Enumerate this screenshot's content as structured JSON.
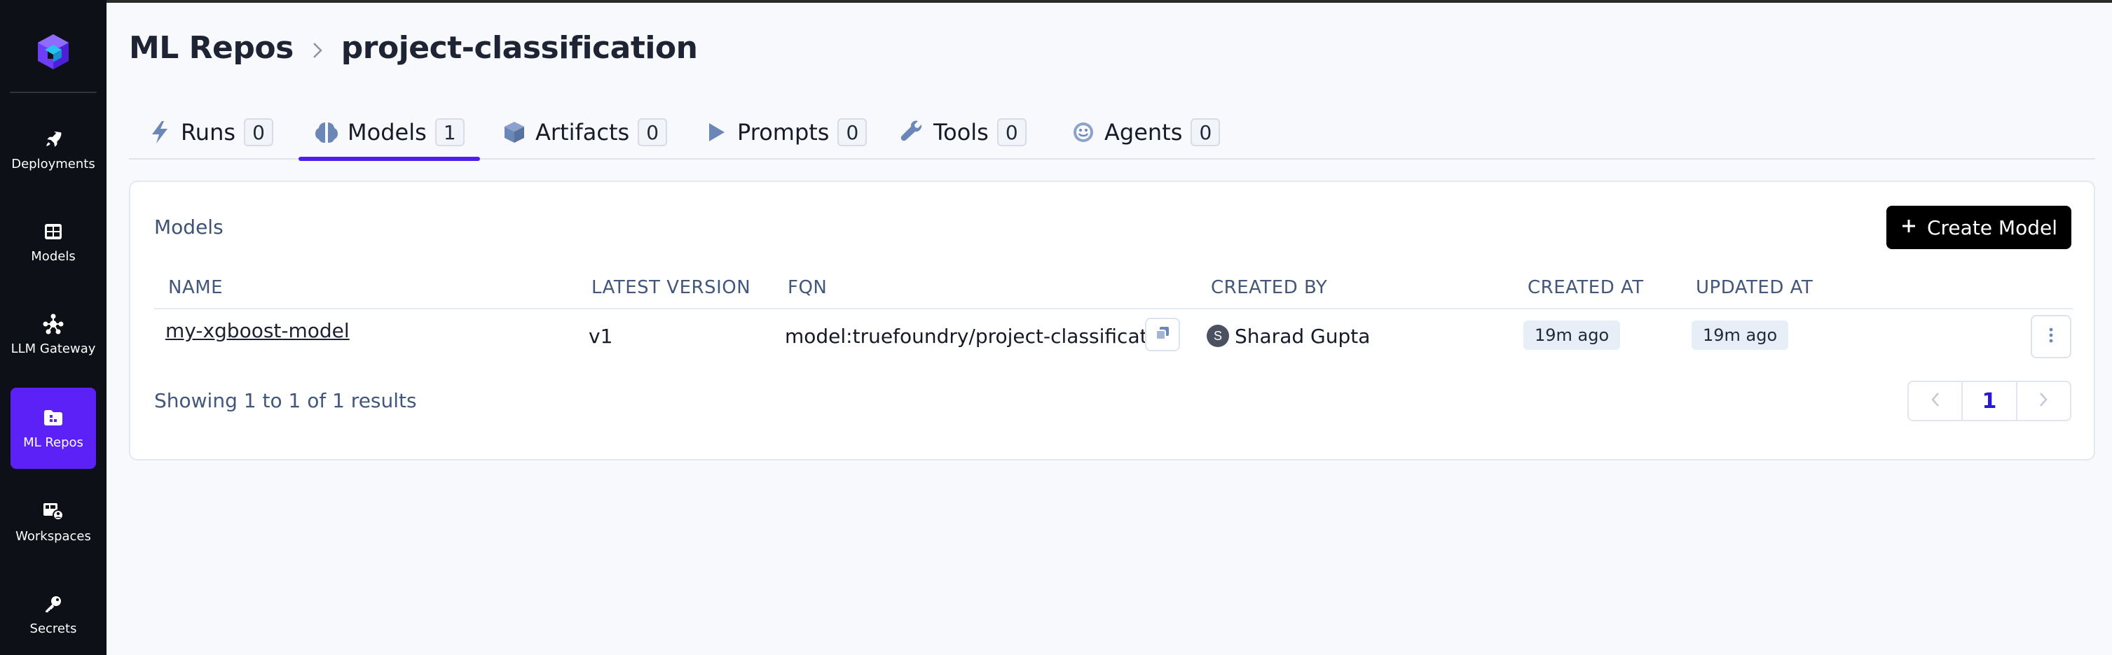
{
  "sidebar": {
    "items": [
      {
        "label": "Deployments",
        "icon": "rocket-icon"
      },
      {
        "label": "Models",
        "icon": "grid-icon"
      },
      {
        "label": "LLM Gateway",
        "icon": "network-icon"
      },
      {
        "label": "ML Repos",
        "icon": "folder-icon",
        "active": true
      },
      {
        "label": "Workspaces",
        "icon": "workspace-icon"
      },
      {
        "label": "Secrets",
        "icon": "key-icon"
      }
    ]
  },
  "header": {
    "breadcrumb_root": "ML Repos",
    "breadcrumb_current": "project-classification"
  },
  "tabs": [
    {
      "label": "Runs",
      "count": "0",
      "icon": "bolt-icon"
    },
    {
      "label": "Models",
      "count": "1",
      "icon": "brain-icon",
      "active": true
    },
    {
      "label": "Artifacts",
      "count": "0",
      "icon": "cube-icon"
    },
    {
      "label": "Prompts",
      "count": "0",
      "icon": "play-icon"
    },
    {
      "label": "Tools",
      "count": "0",
      "icon": "wrench-icon"
    },
    {
      "label": "Agents",
      "count": "0",
      "icon": "smiley-icon"
    }
  ],
  "card": {
    "title": "Models",
    "create_button": "Create Model",
    "columns": {
      "name": "NAME",
      "latest_version": "LATEST VERSION",
      "fqn": "FQN",
      "created_by": "CREATED BY",
      "created_at": "CREATED AT",
      "updated_at": "UPDATED AT"
    },
    "rows": [
      {
        "name": "my-xgboost-model",
        "latest_version": "v1",
        "fqn": "model:truefoundry/project-classificati...",
        "avatar_initial": "S",
        "created_by": "Sharad Gupta",
        "created_at": "19m ago",
        "updated_at": "19m ago"
      }
    ],
    "results_text": "Showing 1 to 1 of 1 results",
    "current_page": "1"
  },
  "colors": {
    "accent": "#5b21f6",
    "tab_underline": "#4f1ff0",
    "sidebar_bg": "#0d1017"
  }
}
